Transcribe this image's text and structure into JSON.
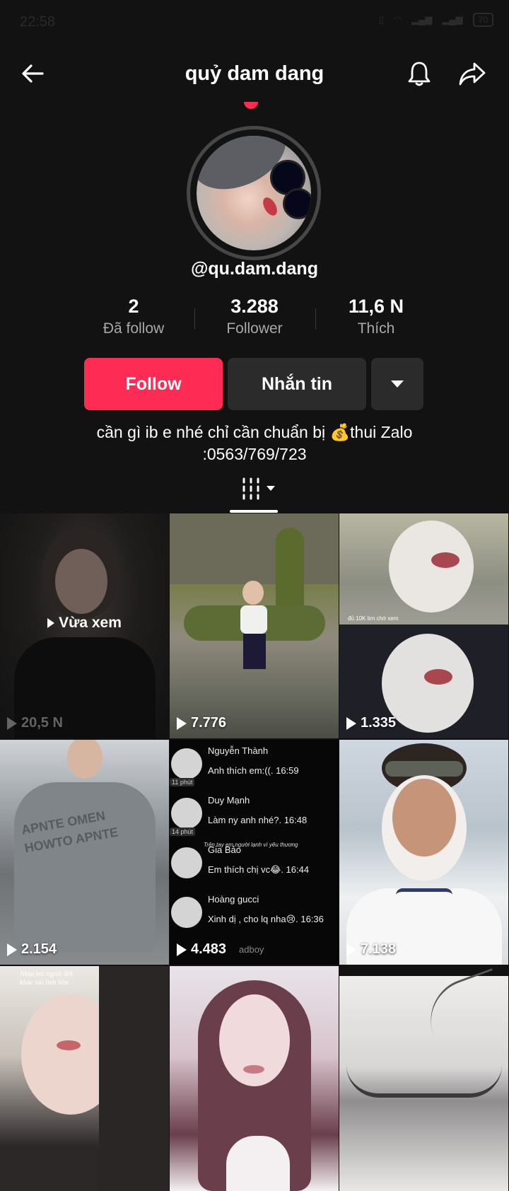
{
  "status_bar": {
    "time": "22:58",
    "battery": "70"
  },
  "header": {
    "title": "quỷ dam dang",
    "icons": {
      "back": "arrow-left-icon",
      "bell": "bell-icon",
      "share": "share-icon"
    }
  },
  "profile": {
    "handle": "@qu.dam.dang",
    "stats": [
      {
        "value": "2",
        "label": "Đã follow"
      },
      {
        "value": "3.288",
        "label": "Follower"
      },
      {
        "value": "11,6 N",
        "label": "Thích"
      }
    ],
    "buttons": {
      "follow": "Follow",
      "message": "Nhắn tin"
    },
    "bio_line1": "cần gì ib e nhé chỉ cần chuẩn bị 💰thui Zalo",
    "bio_line2": ":0563/769/723"
  },
  "videos": [
    {
      "views": "20,5 N",
      "overlay": "Vừa xem"
    },
    {
      "views": "7.776"
    },
    {
      "views": "1.335",
      "caption": "đủ 10K tim chớ xem"
    },
    {
      "views": "2.154"
    },
    {
      "views": "4.483",
      "chat": [
        {
          "name": "Nguyễn Thành",
          "msg": "Anh thích em:((. 16:59",
          "badge": "11 phút"
        },
        {
          "name": "Duy Mạnh",
          "msg": "Làm ny anh nhé?. 16:48",
          "badge": "14 phút"
        },
        {
          "name": "Gia Bảo",
          "msg": "Em thích chị vc😂. 16:44",
          "badge": ""
        },
        {
          "name": "Hoàng gucci",
          "msg": "Xinh dị , cho lq nha😢. 16:36",
          "badge": ""
        }
      ],
      "footer": "adboy",
      "overlay_text": "Trên tay em người lạnh vì yêu thương"
    },
    {
      "views": "7.138"
    },
    {
      "caption": "Nhìn em ngoài đời khác vài linh hồn"
    },
    {},
    {}
  ],
  "colors": {
    "accent": "#fe2c55",
    "background": "#121212",
    "secondary_button": "#2b2b2b"
  }
}
